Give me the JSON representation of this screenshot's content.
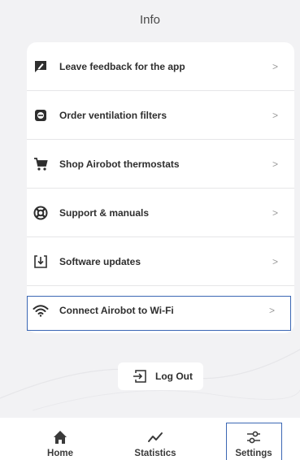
{
  "header": {
    "title": "Info"
  },
  "menu": {
    "items": [
      {
        "label": "Leave feedback for the app",
        "icon": "feedback-icon",
        "chevron": ">"
      },
      {
        "label": "Order ventilation filters",
        "icon": "filter-icon",
        "chevron": ">"
      },
      {
        "label": "Shop Airobot thermostats",
        "icon": "cart-icon",
        "chevron": ">"
      },
      {
        "label": "Support & manuals",
        "icon": "lifebuoy-icon",
        "chevron": ">"
      },
      {
        "label": "Software updates",
        "icon": "download-icon",
        "chevron": ">"
      },
      {
        "label": "Connect Airobot to Wi-Fi",
        "icon": "wifi-icon",
        "chevron": ">",
        "selected": true
      }
    ]
  },
  "logout": {
    "label": "Log Out",
    "icon": "logout-icon"
  },
  "tabbar": {
    "tabs": [
      {
        "label": "Home",
        "icon": "home-icon"
      },
      {
        "label": "Statistics",
        "icon": "statistics-icon"
      },
      {
        "label": "Settings",
        "icon": "settings-sliders-icon",
        "selected": true
      }
    ]
  },
  "colors": {
    "background": "#f2f2f4",
    "card": "#ffffff",
    "text": "#2e2e2e",
    "highlight": "#3b67b4",
    "chevron": "#9a9a9a"
  }
}
